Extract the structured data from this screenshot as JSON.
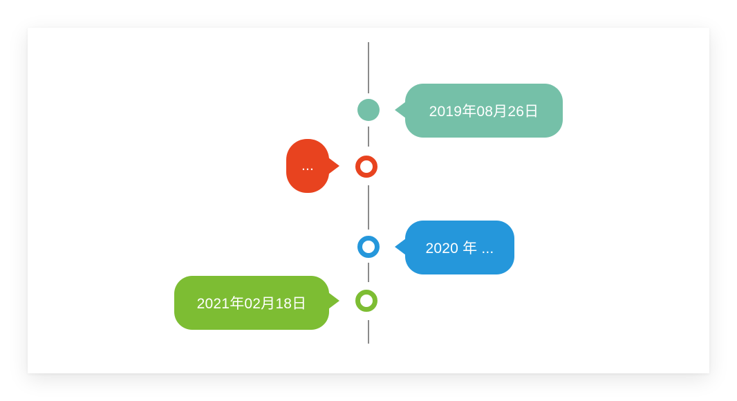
{
  "timeline": {
    "colors": {
      "axis": "#8a8a8a",
      "teal": "#75c0a8",
      "red": "#e8431f",
      "blue": "#2597db",
      "green": "#7dbd33"
    },
    "events": [
      {
        "label": "2019年08月26日",
        "side": "right",
        "color": "#75c0a8",
        "marker": "filled-dot"
      },
      {
        "label": "...",
        "side": "left",
        "color": "#e8431f",
        "marker": "ring"
      },
      {
        "label": "2020 年 ...",
        "side": "right",
        "color": "#2597db",
        "marker": "ring"
      },
      {
        "label": "2021年02月18日",
        "side": "left",
        "color": "#7dbd33",
        "marker": "ring"
      }
    ]
  }
}
